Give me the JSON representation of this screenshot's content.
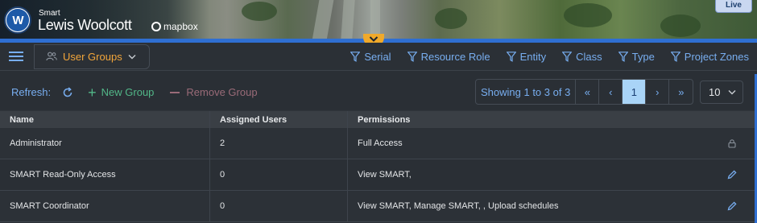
{
  "brand": {
    "small": "Smart",
    "name": "Lewis Woolcott",
    "logo_letters": "W",
    "map_provider": "mapbox",
    "live_badge": "Live"
  },
  "toolbar": {
    "group_label": "User Groups",
    "filters": [
      "Serial",
      "Resource Role",
      "Entity",
      "Class",
      "Type",
      "Project Zones"
    ]
  },
  "actions": {
    "refresh_label": "Refresh:",
    "new_group": "New Group",
    "remove_group": "Remove Group"
  },
  "pagination": {
    "info": "Showing 1 to 3 of 3",
    "first": "«",
    "prev": "‹",
    "current": "1",
    "next": "›",
    "last": "»",
    "per_page": "10"
  },
  "table": {
    "columns": [
      "Name",
      "Assigned Users",
      "Permissions"
    ],
    "rows": [
      {
        "name": "Administrator",
        "users": "2",
        "permissions": "Full Access",
        "action_icon": "lock-icon"
      },
      {
        "name": "SMART Read-Only Access",
        "users": "0",
        "permissions": "View SMART,",
        "action_icon": "edit-icon"
      },
      {
        "name": "SMART Coordinator",
        "users": "0",
        "permissions": "View SMART, Manage SMART, , Upload schedules",
        "action_icon": "edit-icon"
      }
    ]
  },
  "colors": {
    "accent_blue": "#78aef0",
    "accent_orange": "#f3a63a",
    "new_green": "#52b788",
    "remove_red": "#9a6b78",
    "active_page": "#a9d4f7"
  }
}
